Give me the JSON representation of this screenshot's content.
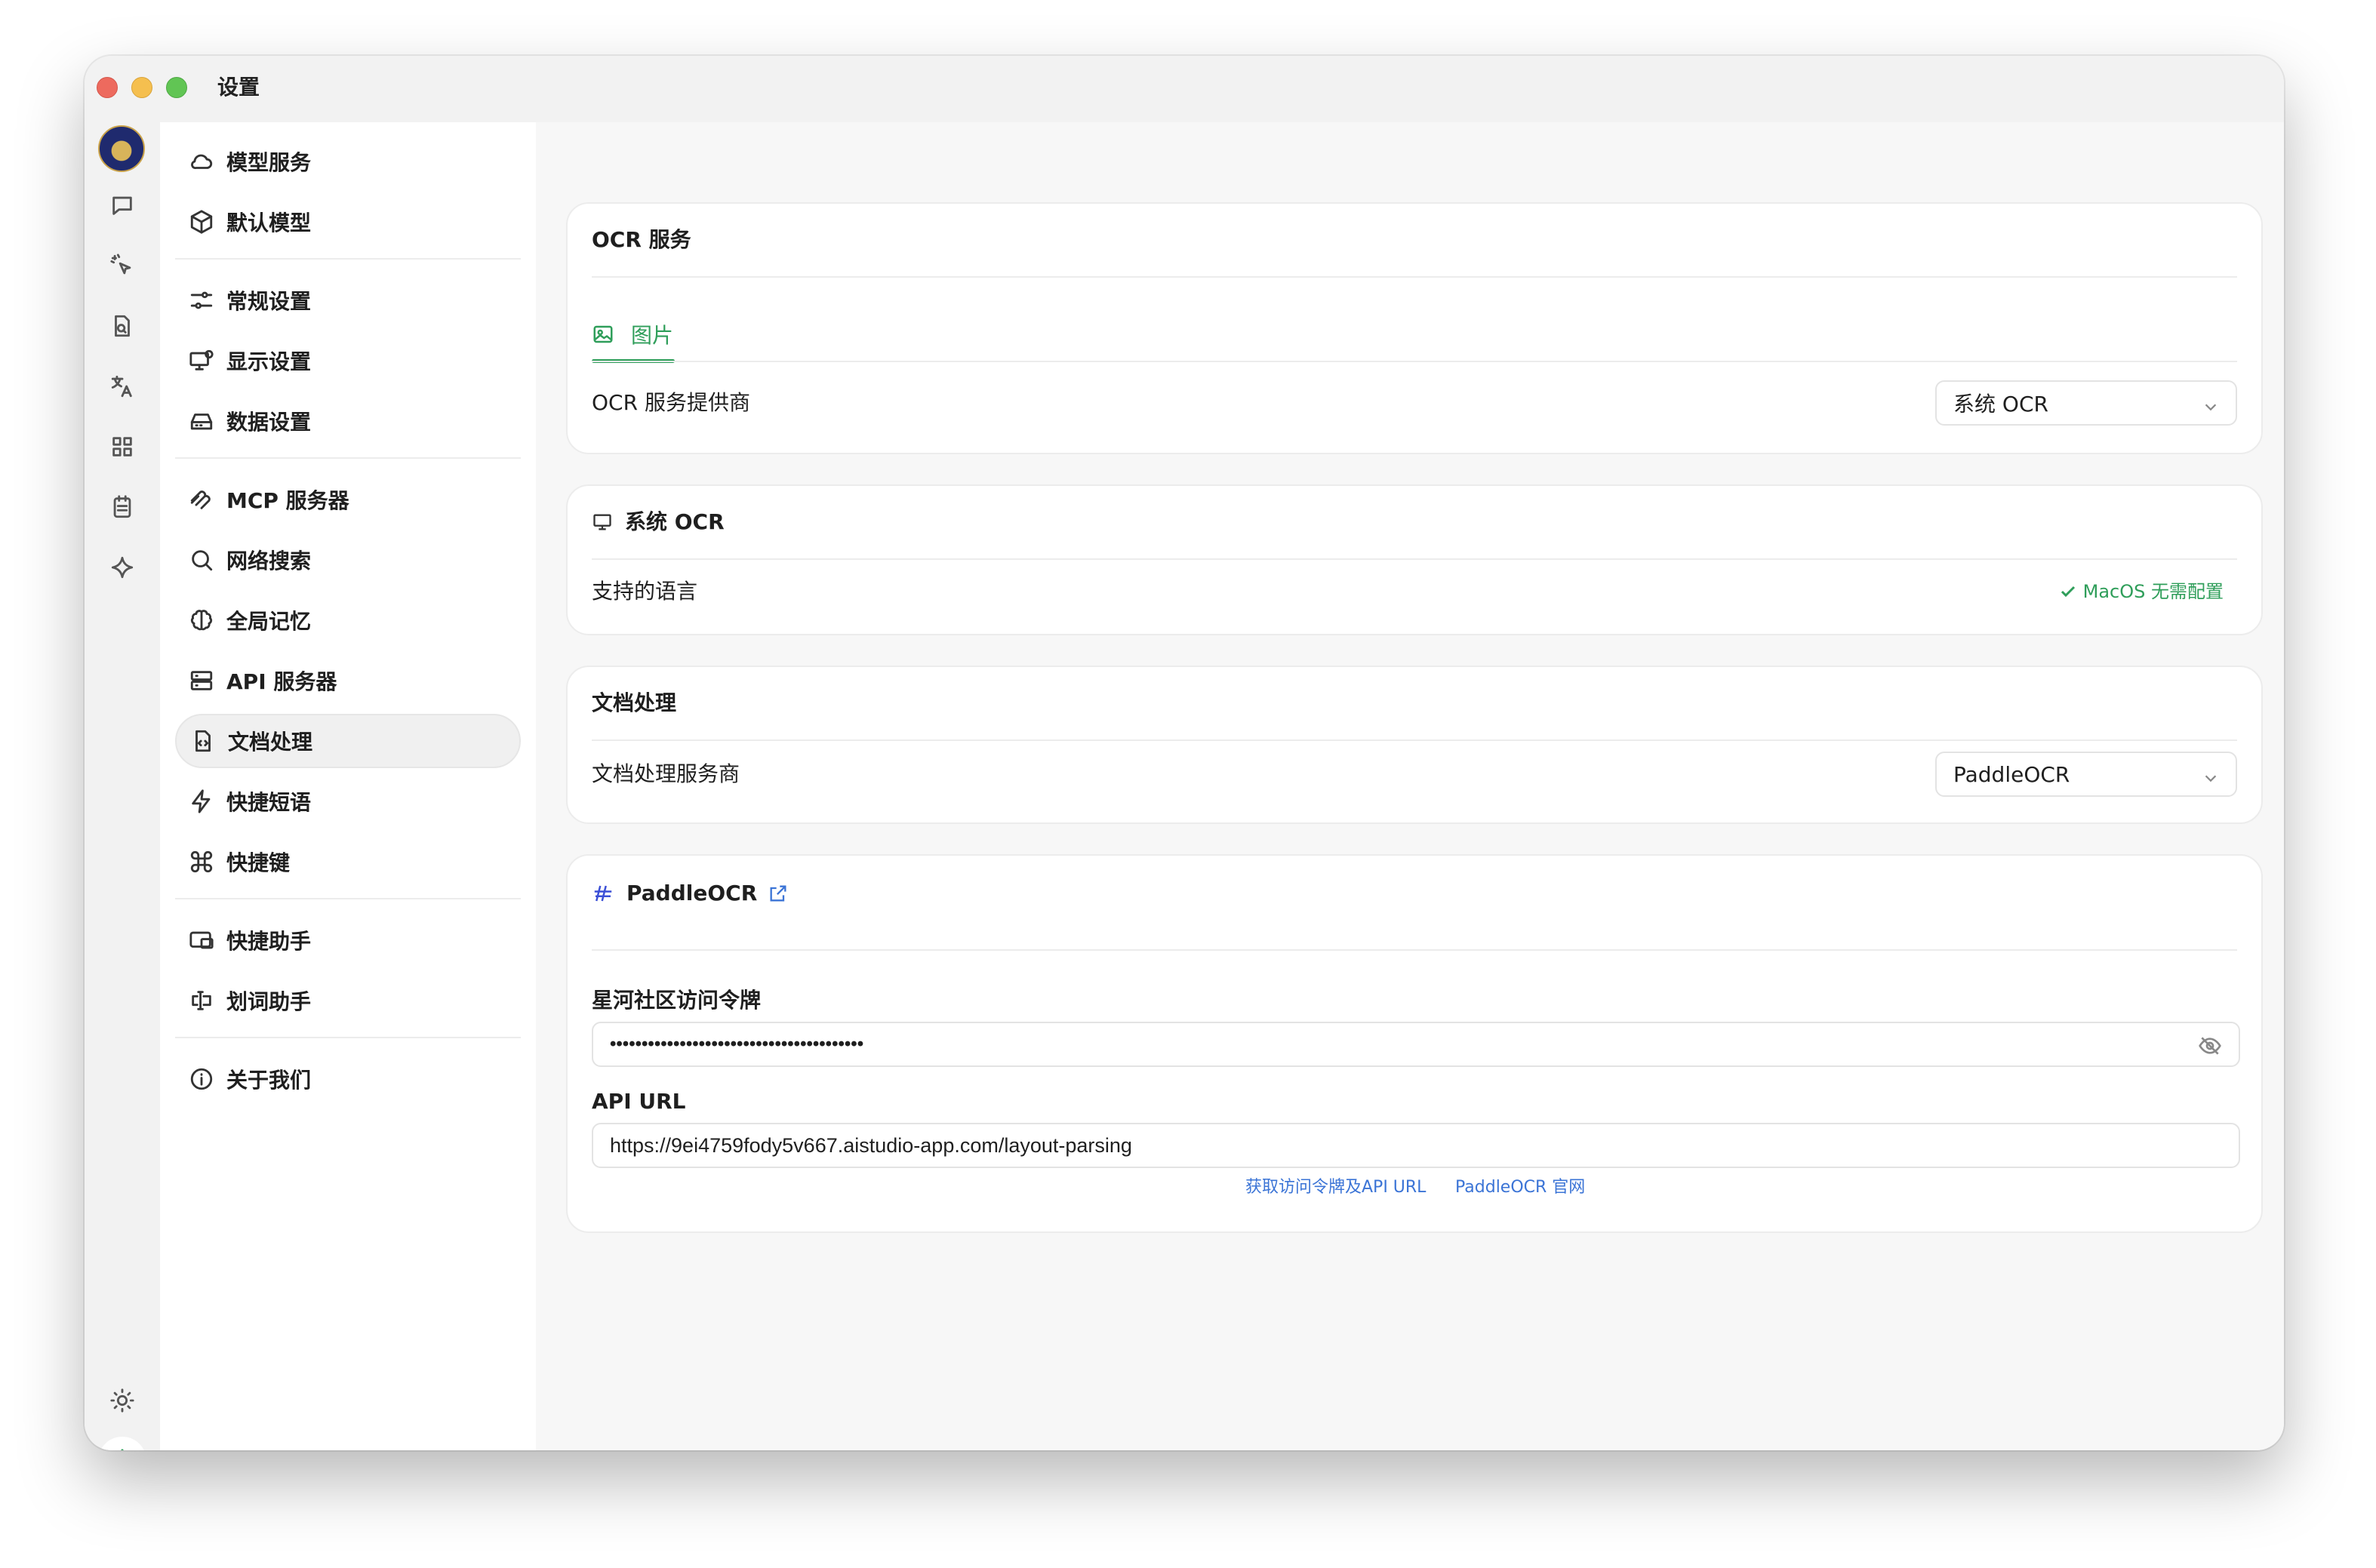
{
  "window": {
    "title": "设置"
  },
  "rail": {
    "icons": [
      "chat-icon",
      "sparkle-cursor-icon",
      "document-search-icon",
      "translate-icon",
      "apps-grid-icon",
      "notes-icon",
      "star-sparkle-icon",
      "sun-icon",
      "gear-icon"
    ]
  },
  "sidebar": {
    "items": [
      {
        "label": "模型服务",
        "icon": "cloud-icon"
      },
      {
        "label": "默认模型",
        "icon": "cube-icon"
      },
      {
        "label": "常规设置",
        "icon": "sliders-icon"
      },
      {
        "label": "显示设置",
        "icon": "monitor-gear-icon"
      },
      {
        "label": "数据设置",
        "icon": "hard-drive-icon"
      },
      {
        "label": "MCP 服务器",
        "icon": "mcp-icon"
      },
      {
        "label": "网络搜索",
        "icon": "search-icon"
      },
      {
        "label": "全局记忆",
        "icon": "brain-icon"
      },
      {
        "label": "API 服务器",
        "icon": "server-icon"
      },
      {
        "label": "文档处理",
        "icon": "document-code-icon"
      },
      {
        "label": "快捷短语",
        "icon": "lightning-icon"
      },
      {
        "label": "快捷键",
        "icon": "command-icon"
      },
      {
        "label": "快捷助手",
        "icon": "window-assistant-icon"
      },
      {
        "label": "划词助手",
        "icon": "text-cursor-icon"
      },
      {
        "label": "关于我们",
        "icon": "info-icon"
      }
    ],
    "active": "文档处理"
  },
  "ocr": {
    "title": "OCR 服务",
    "tab": "图片",
    "provider_label": "OCR 服务提供商",
    "provider_value": "系统 OCR"
  },
  "system_ocr": {
    "title": "系统 OCR",
    "languages_label": "支持的语言",
    "status": "MacOS 无需配置"
  },
  "doc_processing": {
    "title": "文档处理",
    "provider_label": "文档处理服务商",
    "provider_value": "PaddleOCR"
  },
  "paddle": {
    "title": "PaddleOCR",
    "token_label": "星河社区访问令牌",
    "token_value": "••••••••••••••••••••••••••••••••••••••••",
    "api_label": "API URL",
    "api_value": "https://9ei4759fody5v667.aistudio-app.com/layout-parsing",
    "link_token": "获取访问令牌及API URL",
    "link_official": "PaddleOCR 官网"
  },
  "colors": {
    "accent": "#2f9e5a",
    "link": "#3b74d6"
  }
}
